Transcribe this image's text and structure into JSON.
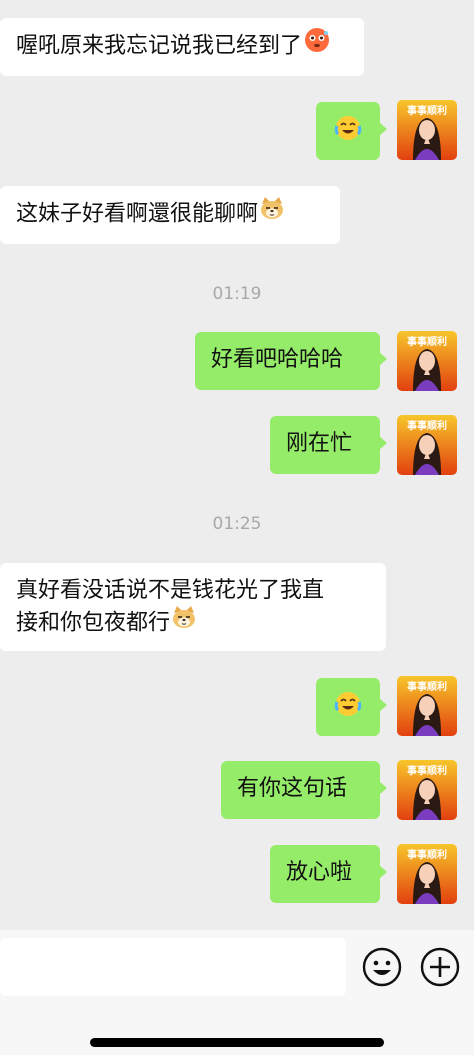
{
  "messages": [
    {
      "side": "left",
      "text": "喔吼原来我忘记说我已经到了",
      "emoji": "flushed-face"
    },
    {
      "side": "right",
      "text": "",
      "emoji": "crying-laughing-face"
    },
    {
      "side": "left",
      "text": "这妹子好看啊還很能聊啊",
      "emoji": "doge-face"
    },
    {
      "time": "01:19"
    },
    {
      "side": "right",
      "text": "好看吧哈哈哈"
    },
    {
      "side": "right",
      "text": "刚在忙"
    },
    {
      "time": "01:25"
    },
    {
      "side": "left",
      "text_line1": "真好看没话说不是钱花光了我直",
      "text_line2": "接和你包夜都行",
      "emoji": "doge-face"
    },
    {
      "side": "right",
      "text": "",
      "emoji": "crying-laughing-face"
    },
    {
      "side": "right",
      "text": "有你这句话"
    },
    {
      "side": "right",
      "text": "放心啦"
    }
  ],
  "avatar": {
    "banner_text": "事事顺利",
    "colors": {
      "bg_top": "#f7c62b",
      "bg_bottom": "#e2400f",
      "hair": "#2b1a13",
      "skin": "#f6d0b8",
      "robe": "#7c3cc0"
    }
  },
  "input_bar": {
    "emoji_icon": "smiley-face-icon",
    "plus_icon": "plus-circle-icon"
  },
  "colors": {
    "background": "#ededed",
    "bubble_self": "#95ec69",
    "bubble_other": "#ffffff",
    "timestamp": "#a8a8a8"
  }
}
